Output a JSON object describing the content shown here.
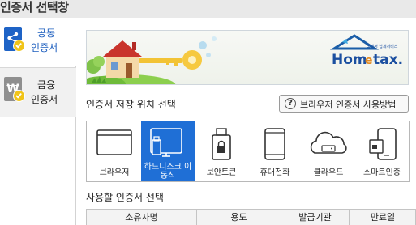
{
  "window": {
    "title": "인증서 선택창"
  },
  "sidebar": {
    "items": [
      {
        "label_line1": "공동",
        "label_line2": "인증서",
        "icon": "share-icon",
        "state": "active"
      },
      {
        "label_line1": "금융",
        "label_line2": "인증서",
        "icon": "won-icon",
        "state": "inactive"
      }
    ]
  },
  "banner": {
    "logo_text_main": "Hom",
    "logo_text_e": "e",
    "logo_text_tax": "tax.",
    "logo_subtitle": "국세청 납세서비스"
  },
  "storage": {
    "section_title": "인증서 저장 위치 선택",
    "help_button_label": "브라우저 인증서 사용방법",
    "items": [
      {
        "label": "브라우저",
        "icon": "browser-window-icon",
        "selected": false
      },
      {
        "label": "하드디스크 이동식",
        "icon": "hard-disk-usb-icon",
        "selected": true
      },
      {
        "label": "보안토큰",
        "icon": "security-token-icon",
        "selected": false
      },
      {
        "label": "휴대전화",
        "icon": "mobile-phone-icon",
        "selected": false
      },
      {
        "label": "클라우드",
        "icon": "cloud-icon",
        "selected": false
      },
      {
        "label": "스마트인증",
        "icon": "smart-auth-icon",
        "selected": false
      }
    ]
  },
  "cert_table": {
    "section_title": "사용할 인증서 선택",
    "columns": [
      "소유자명",
      "용도",
      "발급기관",
      "만료일"
    ]
  },
  "colors": {
    "accent_blue": "#1f6fd6",
    "sidebar_active_text": "#1e5fbf",
    "badge_yellow": "#f0c419"
  }
}
